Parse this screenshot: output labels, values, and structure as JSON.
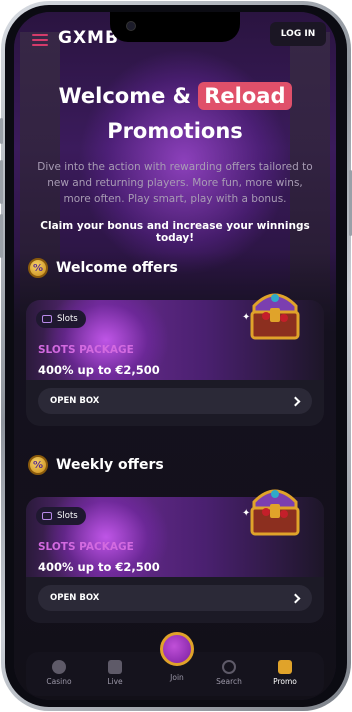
{
  "header": {
    "logo_text": "GXMB",
    "login_label": "LOG IN"
  },
  "hero": {
    "title_part1": "Welcome &",
    "title_highlight": "Reload",
    "title_part2": "Promotions",
    "description": "Dive into the action with rewarding offers tailored to new and returning players. More fun, more wins, more often. Play smart, play with a bonus.",
    "claim": "Claim your bonus and increase your winnings today!"
  },
  "sections": [
    {
      "title": "Welcome offers",
      "card": {
        "chip": "Slots",
        "name": "SLOTS PACKAGE",
        "amount": "400% up to €2,500",
        "button": "OPEN BOX"
      }
    },
    {
      "title": "Weekly offers",
      "card": {
        "chip": "Slots",
        "name": "SLOTS PACKAGE",
        "amount": "400% up to €2,500",
        "button": "OPEN BOX"
      }
    }
  ],
  "nav": {
    "casino": "Casino",
    "live": "Live",
    "join": "Join",
    "search": "Search",
    "promo": "Promo"
  },
  "colors": {
    "accent": "#e0506a",
    "pack_name": "#d36ae0",
    "promo_active": "#e0a32a"
  }
}
